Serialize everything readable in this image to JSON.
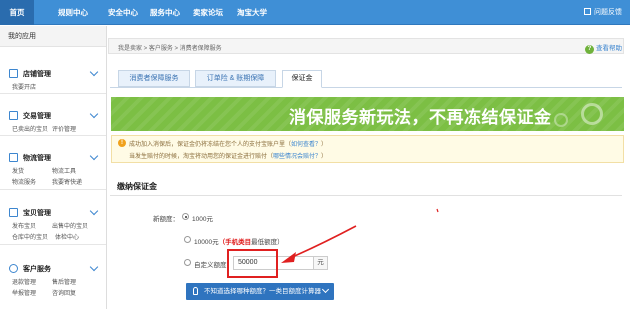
{
  "nav": {
    "items": [
      "首页",
      "规则中心",
      "安全中心",
      "服务中心",
      "卖家论坛",
      "淘宝大学"
    ],
    "active_index": 0,
    "feedback": "问题反馈"
  },
  "sidebar": {
    "title": "我的应用",
    "groups": [
      {
        "label": "店铺管理",
        "icon": "shop-icon",
        "links": [
          "我要开店"
        ]
      },
      {
        "label": "交易管理",
        "icon": "trade-icon",
        "links": [
          "已卖出的宝贝",
          "评价管理"
        ]
      },
      {
        "label": "物流管理",
        "icon": "truck-icon",
        "links": [
          "发货",
          "物流工具",
          "物流服务",
          "我要寄快递"
        ]
      },
      {
        "label": "宝贝管理",
        "icon": "goods-icon",
        "links": [
          "发布宝贝",
          "出售中的宝贝",
          "仓库中的宝贝",
          "体检中心"
        ]
      },
      {
        "label": "客户服务",
        "icon": "service-icon",
        "links": [
          "退款管理",
          "售后管理",
          "举报管理",
          "咨询回复"
        ]
      }
    ]
  },
  "breadcrumb": "我是卖家 > 客户服务 > 消费者保障服务",
  "help": "查看帮助",
  "tabs": [
    "消费者保障服务",
    "订单险 & 账期保障",
    "保证金"
  ],
  "active_tab": 2,
  "banner": "消保服务新玩法，不再冻结保证金",
  "notice": {
    "line1": "成功加入消保后，保证金仍将冻结在您个人的支付宝账户里（",
    "line1_link": "如何查看？",
    "line1_end": "）",
    "line2": "当发生赔付的时候，淘宝将动用您的保证金进行赔付（",
    "line2_link": "哪些情况会赔付？",
    "line2_end": "）"
  },
  "section": {
    "title": "缴纳保证金",
    "amount_label": "新额度：",
    "option1": "1000元",
    "option2_amount": "10000元",
    "option2_note_red": "（手机类目",
    "option2_note": "最低额度）",
    "option3": "自定义额度",
    "custom_value": "50000",
    "unit": "元",
    "calc_button": "不知道选择哪种额度？一类目额度计算器"
  },
  "colors": {
    "nav_blue": "#3f8fd6",
    "banner_green": "#7cbf44",
    "annotation_red": "#e02020"
  }
}
